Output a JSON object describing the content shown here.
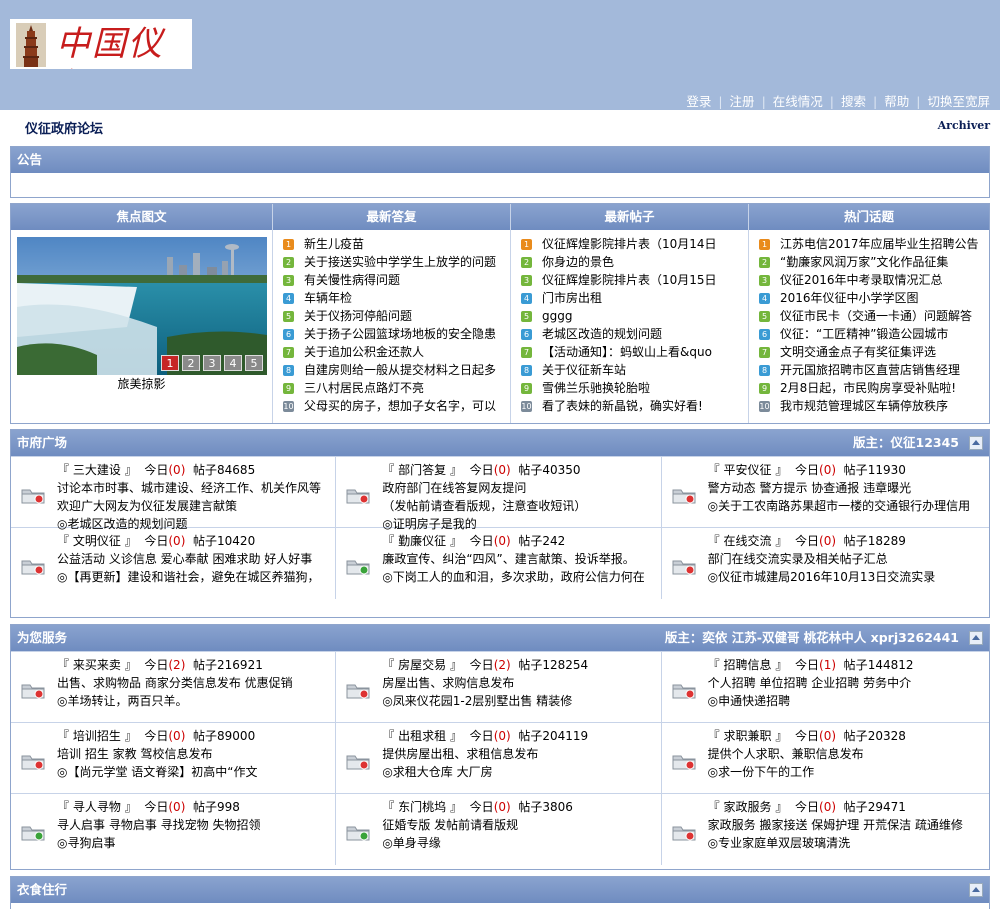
{
  "header": {
    "logo_text": "中国仪征",
    "nav": [
      "登录",
      "注册",
      "在线情况",
      "搜索",
      "帮助",
      "切换至宽屏"
    ]
  },
  "crumb": "仪征政府论坛",
  "archiver": "Archiver",
  "notice": {
    "title": "公告"
  },
  "quad": {
    "headers": [
      "焦点图文",
      "最新答复",
      "最新帖子",
      "热门话题"
    ],
    "photo_caption": "旅美掠影",
    "pager": [
      "1",
      "2",
      "3",
      "4",
      "5"
    ],
    "latest_replies": [
      "新生儿疫苗",
      "关于接送实验中学学生上放学的问题",
      "有关慢性病得问题",
      "车辆年检",
      "关于仪扬河停船问题",
      "关于扬子公园篮球场地板的安全隐患",
      "关于追加公积金还款人",
      "自建房则给一般从提交材料之日起多",
      "三八村居民点路灯不亮",
      "父母买的房子，想加子女名字，可以"
    ],
    "latest_posts": [
      "仪征辉煌影院排片表（10月14日",
      "你身边的景色",
      "仪征辉煌影院排片表（10月15日",
      "门市房出租",
      "gggg",
      "老城区改造的规划问题",
      "【活动通知】：蚂蚁山上看&quo",
      "关于仪征新车站",
      "雪佛兰乐驰换轮胎啦",
      "看了表妹的新晶锐，确实好看!"
    ],
    "hot_topics": [
      "江苏电信2017年应届毕业生招聘公告",
      "“勤廉家风润万家”文化作品征集",
      "仪征2016年中考录取情况汇总",
      "2016年仪征中小学学区图",
      "仪征市民卡（交通一卡通）问题解答",
      "仪征：“工匠精神”锻造公园城市",
      "文明交通金点子有奖征集评选",
      "开元国旅招聘市区直营店销售经理",
      "2月8日起，市民购房享受补贴啦!",
      "我市规范管理城区车辆停放秩序"
    ]
  },
  "plaza": {
    "title": "市府广场",
    "moderators": "版主：仪征12345",
    "forums": [
      {
        "name": "三大建设",
        "today": "0",
        "posts": "84685",
        "desc": "讨论本市时事、城市建设、经济工作、机关作风等",
        "desc2": "欢迎广大网友为仪征发展建言献策",
        "last": "◎老城区改造的规划问题"
      },
      {
        "name": "部门答复",
        "today": "0",
        "posts": "40350",
        "desc": "政府部门在线答复网友提问",
        "desc2": "（发帖前请查看版规，注意查收短讯）",
        "last": "◎证明房子是我的"
      },
      {
        "name": "平安仪征",
        "today": "0",
        "posts": "11930",
        "desc": "警方动态  警方提示  协查通报  违章曝光",
        "desc2": "",
        "last": "◎关于工农南路苏果超市一楼的交通银行办理信用"
      },
      {
        "name": "文明仪征",
        "today": "0",
        "posts": "10420",
        "desc": "公益活动  义诊信息  爱心奉献  困难求助  好人好事",
        "desc2": "",
        "last": "◎【再更新】建设和谐社会，避免在城区养猫狗，"
      },
      {
        "name": "勤廉仪征",
        "today": "0",
        "posts": "242",
        "desc": "廉政宣传、纠治“四风”、建言献策、投诉举报。",
        "desc2": "",
        "last": "◎下岗工人的血和泪，多次求助，政府公信力何在"
      },
      {
        "name": "在线交流",
        "today": "0",
        "posts": "18289",
        "desc": "部门在线交流实录及相关帖子汇总",
        "desc2": "",
        "last": "◎仪征市城建局2016年10月13日交流实录"
      }
    ]
  },
  "service": {
    "title": "为您服务",
    "moderators": "版主：奕依  江苏-双健哥  桃花林中人  xprj3262441",
    "forums": [
      {
        "name": "来买来卖",
        "today": "2",
        "posts": "216921",
        "desc": "出售、求购物品  商家分类信息发布  优惠促销",
        "last": "◎羊场转让，两百只羊。"
      },
      {
        "name": "房屋交易",
        "today": "2",
        "posts": "128254",
        "desc": "房屋出售、求购信息发布",
        "last": "◎凤来仪花园1-2层别墅出售  精装修"
      },
      {
        "name": "招聘信息",
        "today": "1",
        "posts": "144812",
        "desc": "个人招聘  单位招聘  企业招聘  劳务中介",
        "last": "◎申通快递招聘"
      },
      {
        "name": "培训招生",
        "today": "0",
        "posts": "89000",
        "desc": "培训  招生  家教  驾校信息发布",
        "last": "◎【尚元学堂  语文脊梁】初高中“作文"
      },
      {
        "name": "出租求租",
        "today": "0",
        "posts": "204119",
        "desc": "提供房屋出租、求租信息发布",
        "last": "◎求租大仓库  大厂房"
      },
      {
        "name": "求职兼职",
        "today": "0",
        "posts": "20328",
        "desc": "提供个人求职、兼职信息发布",
        "last": "◎求一份下午的工作"
      },
      {
        "name": "寻人寻物",
        "today": "0",
        "posts": "998",
        "desc": "寻人启事  寻物启事  寻找宠物  失物招领",
        "last": "◎寻狗启事"
      },
      {
        "name": "东门桃坞",
        "today": "0",
        "posts": "3806",
        "desc": "征婚专版  发帖前请看版规",
        "last": "◎单身寻缘"
      },
      {
        "name": "家政服务",
        "today": "0",
        "posts": "29471",
        "desc": "家政服务  搬家接送  保姆护理  开荒保洁  疏通维修",
        "last": "◎专业家庭单双层玻璃清洗"
      }
    ]
  },
  "food": {
    "title": "衣食住行"
  },
  "labels": {
    "today": "今日",
    "posts": "帖子",
    "open": "『",
    "close": "』"
  }
}
